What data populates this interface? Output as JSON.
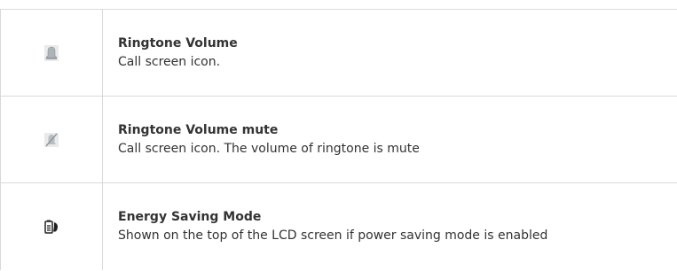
{
  "rows": [
    {
      "icon": "bell-icon",
      "title": "Ringtone Volume",
      "description": "Call screen icon."
    },
    {
      "icon": "bell-mute-icon",
      "title": "Ringtone Volume mute",
      "description": "Call screen icon. The volume of ringtone is mute"
    },
    {
      "icon": "energy-saving-icon",
      "title": "Energy Saving Mode",
      "description": "Shown on the top of the LCD screen if power saving mode is enabled"
    }
  ],
  "colors": {
    "border": "#d9d9d9",
    "text": "#333333",
    "icon_gray": "#b5b9bc"
  }
}
